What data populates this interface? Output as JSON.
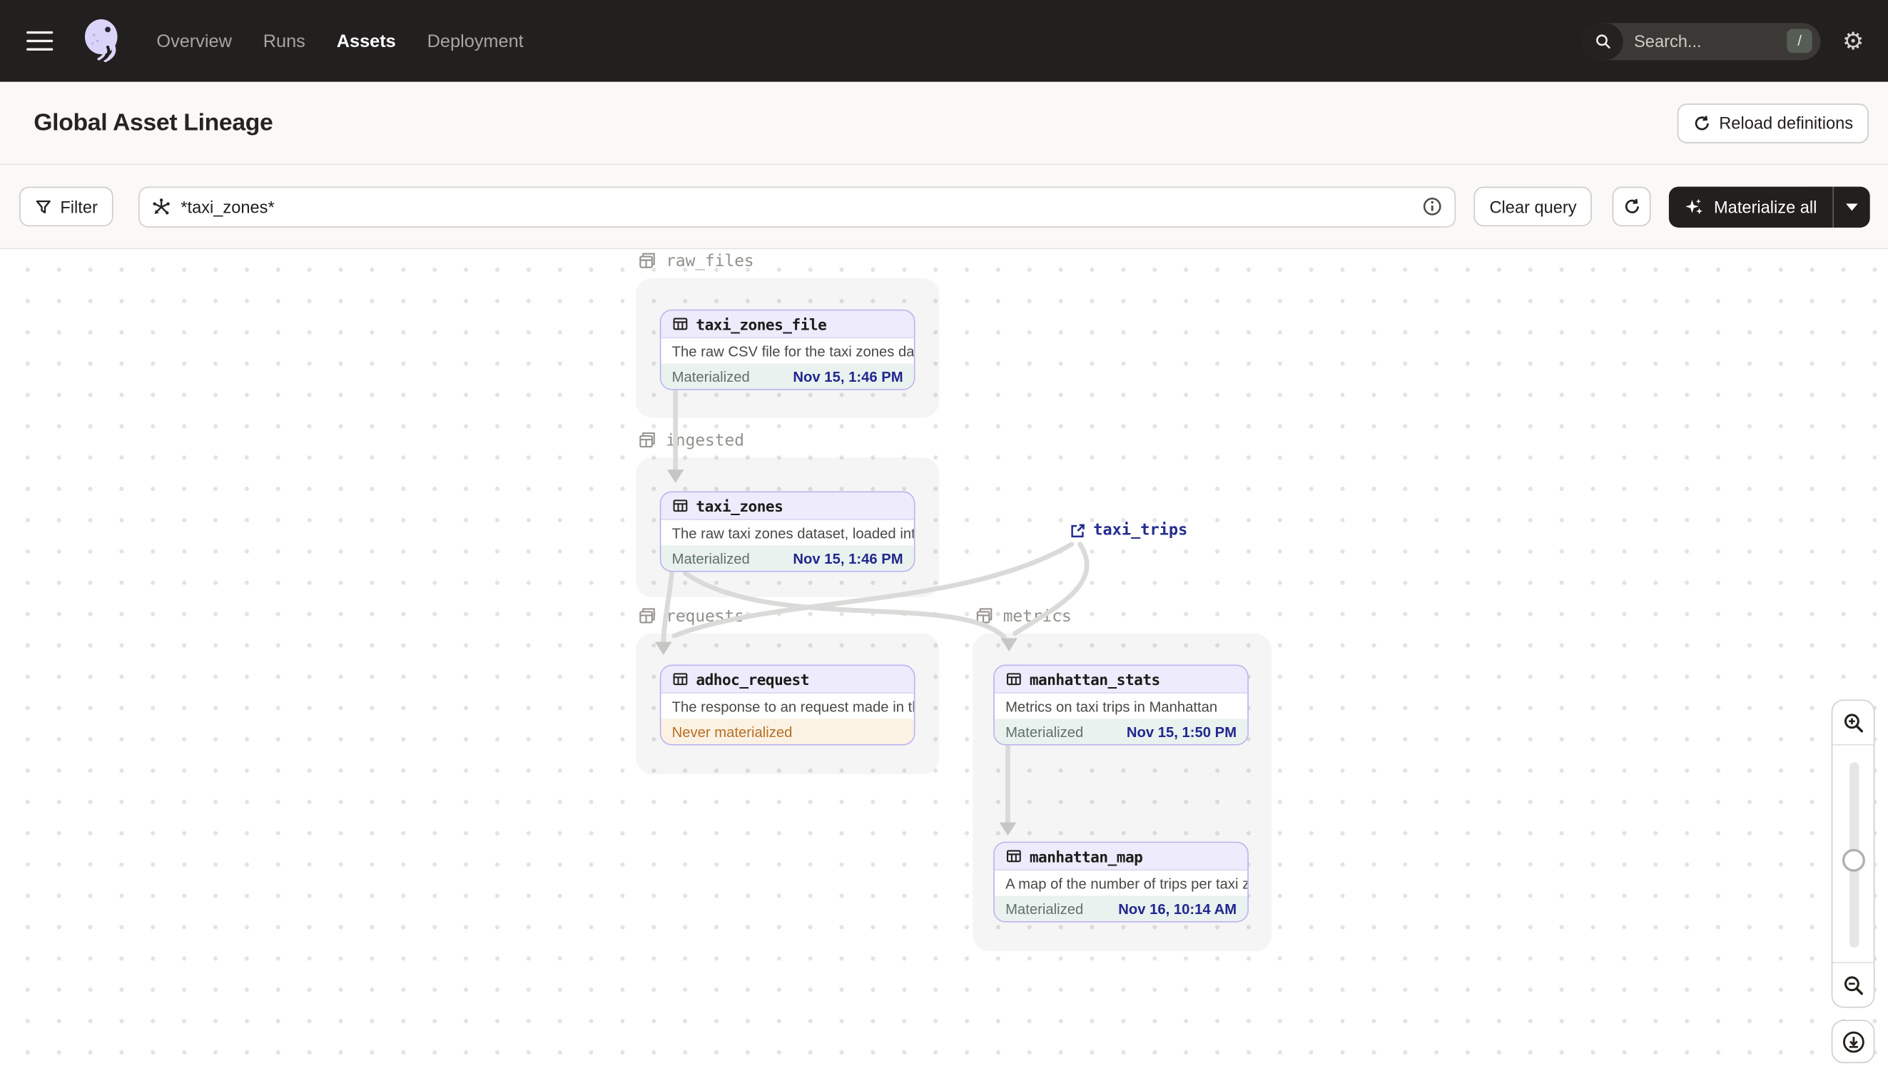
{
  "nav": {
    "links": [
      {
        "label": "Overview"
      },
      {
        "label": "Runs"
      },
      {
        "label": "Assets"
      },
      {
        "label": "Deployment"
      }
    ],
    "active_link": "Assets",
    "search_placeholder": "Search...",
    "search_shortcut": "/"
  },
  "header": {
    "title": "Global Asset Lineage",
    "reload_label": "Reload definitions"
  },
  "toolbar": {
    "filter_label": "Filter",
    "query_value": "*taxi_zones*",
    "clear_label": "Clear query",
    "materialize_label": "Materialize all"
  },
  "graph": {
    "groups": [
      {
        "label": "raw_files",
        "assets": [
          {
            "name": "taxi_zones_file",
            "description": "The raw CSV file for the taxi zones dat...",
            "status": "Materialized",
            "timestamp": "Nov 15, 1:46 PM"
          }
        ]
      },
      {
        "label": "ingested",
        "assets": [
          {
            "name": "taxi_zones",
            "description": "The raw taxi zones dataset, loaded int...",
            "status": "Materialized",
            "timestamp": "Nov 15, 1:46 PM"
          }
        ]
      },
      {
        "label": "requests",
        "assets": [
          {
            "name": "adhoc_request",
            "description": "The response to an request made in th...",
            "status": "Never materialized",
            "timestamp": ""
          }
        ]
      },
      {
        "label": "metrics",
        "assets": [
          {
            "name": "manhattan_stats",
            "description": "Metrics on taxi trips in Manhattan",
            "status": "Materialized",
            "timestamp": "Nov 15, 1:50 PM"
          },
          {
            "name": "manhattan_map",
            "description": "A map of the number of trips per taxi z...",
            "status": "Materialized",
            "timestamp": "Nov 16, 10:14 AM"
          }
        ]
      }
    ],
    "external_asset": {
      "name": "taxi_trips"
    }
  },
  "colors": {
    "nav_bg": "#221f1f",
    "asset_accent_purple": "#bcb3ee",
    "asset_header_bg": "#edebfc",
    "materialized_bg": "#e9f2ee",
    "timestamp_blue": "#21288e",
    "never_materialized_text": "#b96d24",
    "never_materialized_bg": "#fbf2e4",
    "external_asset_navy": "#232c90"
  }
}
